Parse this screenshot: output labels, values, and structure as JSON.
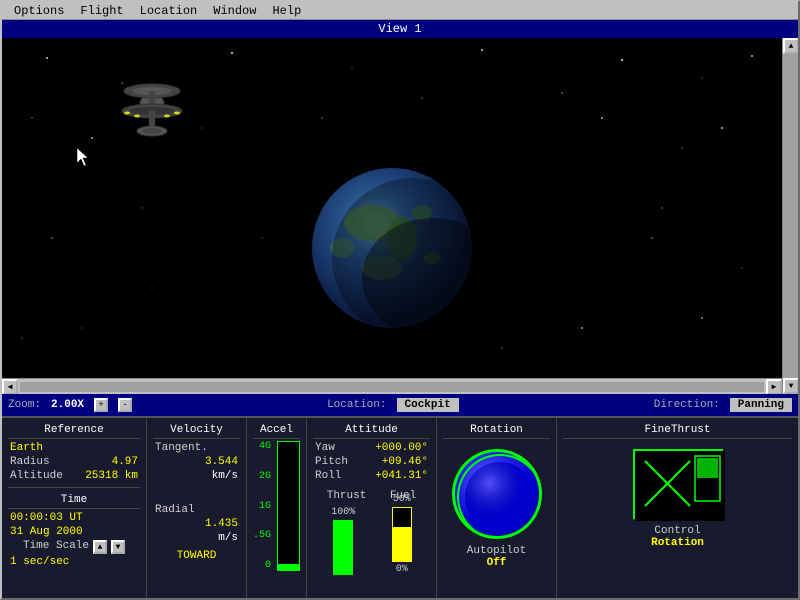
{
  "window": {
    "title": "View 1"
  },
  "menu": {
    "items": [
      "Options",
      "Flight",
      "Location",
      "Window",
      "Help"
    ]
  },
  "statusbar": {
    "zoom_label": "Zoom:",
    "zoom_value": "2.00X",
    "zoom_plus": "+",
    "zoom_minus": "-",
    "location_label": "Location:",
    "location_value": "Cockpit",
    "direction_label": "Direction:",
    "direction_value": "Panning"
  },
  "panel": {
    "reference": {
      "title": "Reference",
      "earth_label": "Earth",
      "radius_label": "Radius",
      "radius_value": "4.97",
      "altitude_label": "Altitude",
      "altitude_value": "25318 km"
    },
    "time": {
      "title": "Time",
      "time_value": "00:00:03 UT",
      "date_value": "31 Aug 2000",
      "scale_label": "Time Scale",
      "scale_value": "1 sec/sec"
    },
    "velocity": {
      "title": "Velocity",
      "tangent_label": "Tangent.",
      "tangent_value": "3.544",
      "unit": "km/s",
      "radial_label": "Radial",
      "radial_value": "1.435",
      "radial_unit": "m/s",
      "direction_value": "TOWARD"
    },
    "accel": {
      "title": "Accel",
      "marks": [
        "4G",
        "2G",
        "1G",
        ".5G",
        "0"
      ]
    },
    "attitude": {
      "title": "Attitude",
      "yaw_label": "Yaw",
      "yaw_value": "+000.00°",
      "pitch_label": "Pitch",
      "pitch_value": "+09.46°",
      "roll_label": "Roll",
      "roll_value": "+041.31°",
      "thrust_label": "Thrust",
      "fuel_label": "Fuel",
      "thrust_pct": "100%",
      "fuel_50": "50%",
      "fuel_0": "0%"
    },
    "rotation": {
      "title": "Rotation",
      "autopilot_label": "Autopilot",
      "autopilot_value": "Off"
    },
    "finethrust": {
      "title": "FineThrust",
      "control_label": "Control",
      "control_value": "Rotation"
    }
  }
}
